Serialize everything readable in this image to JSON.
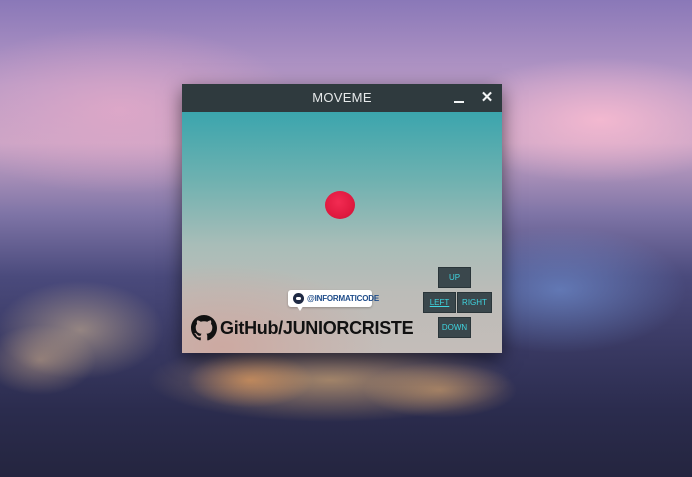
{
  "window": {
    "title": "MOVEME",
    "minimize_icon": "minimize-icon",
    "close_icon": "close-icon",
    "close_glyph": "✕"
  },
  "canvas": {
    "ball_color": "#e8183f",
    "twitter_badge": {
      "icon": "twitter-avatar-icon",
      "handle": "@INFORMATICODE"
    },
    "github": {
      "icon": "github-icon",
      "label": "GitHub/JUNIORCRISTE"
    }
  },
  "controls": {
    "up": "UP",
    "left": "LEFT",
    "right": "RIGHT",
    "down": "DOWN"
  },
  "colors": {
    "titlebar": "#2f3a3e",
    "button_bg": "#3a474c",
    "button_text": "#3fd5e0"
  }
}
